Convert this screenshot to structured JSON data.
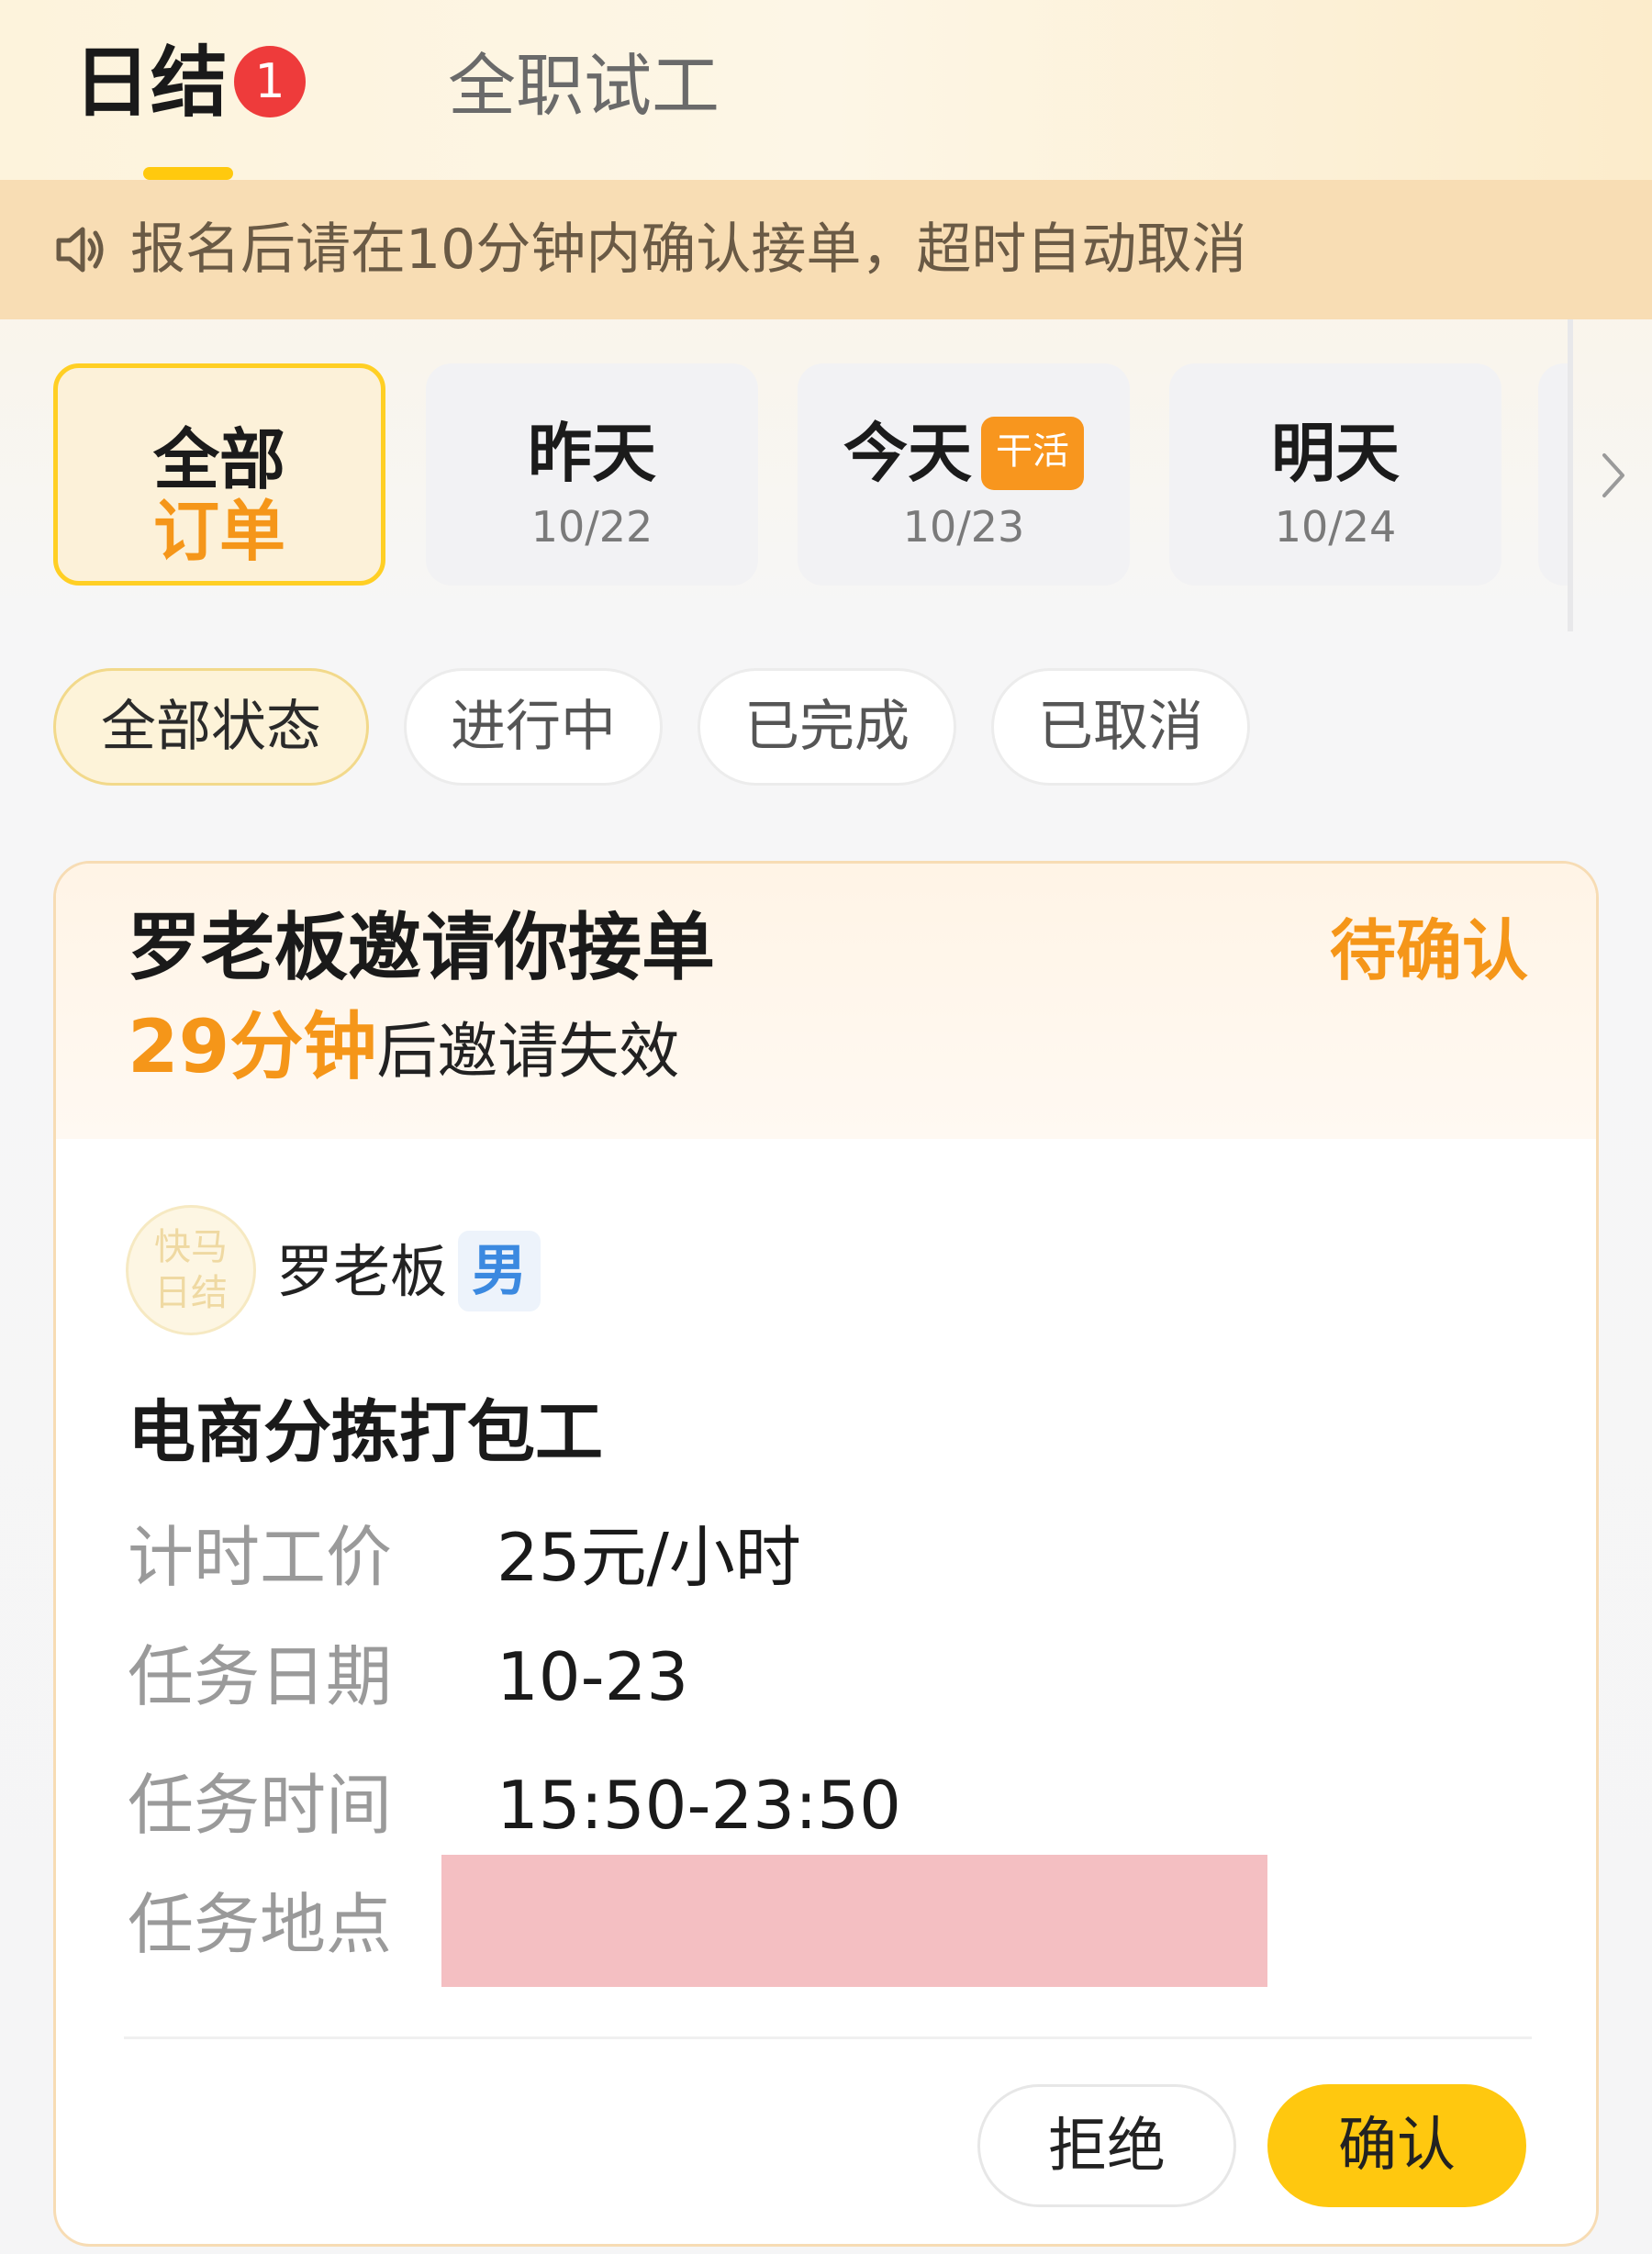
{
  "header": {
    "tabs": [
      {
        "label": "日结",
        "badge": "1",
        "active": true
      },
      {
        "label": "全职试工",
        "active": false
      }
    ]
  },
  "notice": {
    "icon": "speaker-icon",
    "text": "报名后请在10分钟内确认接单，超时自动取消"
  },
  "date_filter": {
    "items": [
      {
        "line1": "全部",
        "line2": "订单",
        "active": true
      },
      {
        "label": "昨天",
        "date": "10/22"
      },
      {
        "label": "今天",
        "date": "10/23",
        "badge": "干活"
      },
      {
        "label": "明天",
        "date": "10/24"
      }
    ],
    "more_icon": "chevron-right-icon"
  },
  "status_filter": {
    "items": [
      {
        "label": "全部状态",
        "active": true
      },
      {
        "label": "进行中"
      },
      {
        "label": "已完成"
      },
      {
        "label": "已取消"
      }
    ]
  },
  "order": {
    "title": "罗老板邀请你接单",
    "status": "待确认",
    "expire_time": "29分钟",
    "expire_text": "后邀请失效",
    "avatar_text_1": "快马",
    "avatar_text_2": "日结",
    "poster_name": "罗老板",
    "poster_gender": "男",
    "job_title": "电商分拣打包工",
    "rows": [
      {
        "label": "计时工价",
        "value": "25元/小时"
      },
      {
        "label": "任务日期",
        "value": "10-23"
      },
      {
        "label": "任务时间",
        "value": "15:50-23:50"
      },
      {
        "label": "任务地点",
        "value": ""
      }
    ],
    "reject_label": "拒绝",
    "confirm_label": "确认"
  },
  "colors": {
    "accent": "#ffc80f",
    "orange": "#f59619",
    "badge_red": "#ee3b3b",
    "gender_blue": "#3b89e0"
  }
}
